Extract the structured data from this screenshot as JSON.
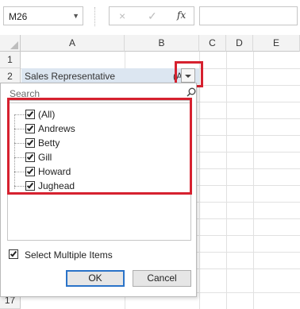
{
  "formula_bar": {
    "name_box": "M26",
    "cancel_icon": "×",
    "enter_icon": "✓",
    "fx_label": "fx"
  },
  "columns": [
    "A",
    "B",
    "C",
    "D",
    "E"
  ],
  "rows": [
    "1",
    "2",
    "17"
  ],
  "cell_a2": "Sales Representative",
  "cell_b2": "(All)",
  "filter_panel": {
    "search_placeholder": "Search",
    "items": [
      {
        "label": "(All)",
        "checked": true
      },
      {
        "label": "Andrews",
        "checked": true
      },
      {
        "label": "Betty",
        "checked": true
      },
      {
        "label": "Gill",
        "checked": true
      },
      {
        "label": "Howard",
        "checked": true
      },
      {
        "label": "Jughead",
        "checked": true
      }
    ],
    "select_multiple_label": "Select Multiple Items",
    "select_multiple_checked": true,
    "ok_label": "OK",
    "cancel_label": "Cancel"
  },
  "colors": {
    "highlight": "#d6212f",
    "header_bg": "#f3f3f3",
    "selected_cell": "#dce6f1",
    "ok_border": "#2a73c8"
  }
}
